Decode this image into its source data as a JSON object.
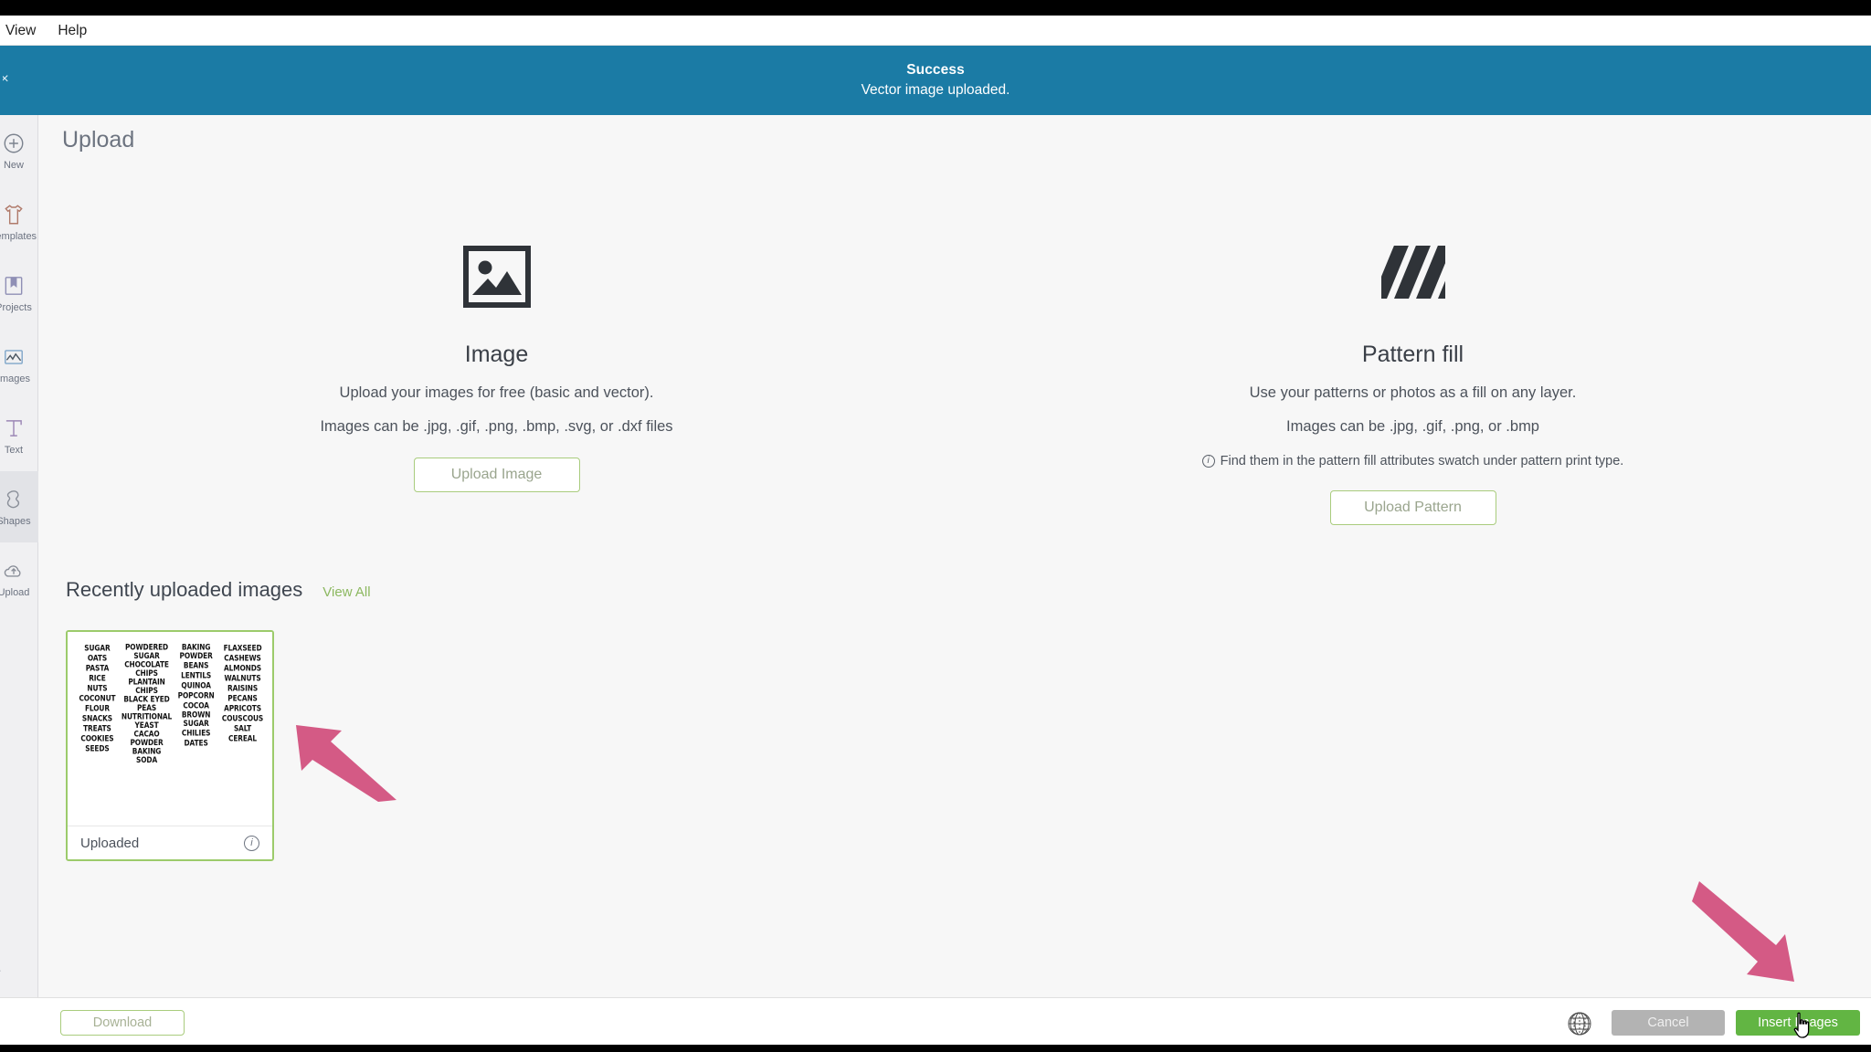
{
  "menubar": {
    "items": [
      "View",
      "Help"
    ]
  },
  "banner": {
    "title": "Success",
    "message": "Vector image uploaded.",
    "close_icon": "close-icon",
    "color": "#1b7ba5"
  },
  "sidebar": {
    "items": [
      {
        "label": "New",
        "icon": "plus-circle-icon",
        "active": false
      },
      {
        "label": "Templates",
        "icon": "tshirt-icon",
        "active": false
      },
      {
        "label": "Projects",
        "icon": "bookmark-icon",
        "active": false
      },
      {
        "label": "Images",
        "icon": "image-graph-icon",
        "active": false
      },
      {
        "label": "Text",
        "icon": "text-icon",
        "active": false
      },
      {
        "label": "Shapes",
        "icon": "shapes-icon",
        "active": true
      },
      {
        "label": "Upload",
        "icon": "upload-cloud-icon",
        "active": false
      }
    ],
    "collapse_icon": "chevron-right-icon"
  },
  "page": {
    "title": "Upload"
  },
  "cards": [
    {
      "icon": "image-icon",
      "title": "Image",
      "line1": "Upload your images for free (basic and vector).",
      "line2": "Images can be .jpg, .gif, .png, .bmp, .svg, or .dxf files",
      "note": "",
      "button": "Upload Image"
    },
    {
      "icon": "pattern-stripes-icon",
      "title": "Pattern fill",
      "line1": "Use your patterns or photos as a fill on any layer.",
      "line2": "Images can be .jpg, .gif, .png, or .bmp",
      "note": "Find them in the pattern fill attributes swatch under pattern print type.",
      "button": "Upload Pattern"
    }
  ],
  "recent": {
    "title": "Recently uploaded images",
    "view_all": "View All",
    "thumbnail": {
      "status": "Uploaded",
      "info_icon": "info-icon",
      "columns": [
        [
          "SUGAR",
          "OATS",
          "PASTA",
          "RICE",
          "NUTS",
          "COCONUT",
          "FLOUR",
          "SNACKS",
          "TREATS",
          "COOKIES",
          "SEEDS"
        ],
        [
          "POWDERED SUGAR",
          "CHOCOLATE CHIPS",
          "PLANTAIN CHIPS",
          "BLACK EYED PEAS",
          "NUTRITIONAL YEAST",
          "CACAO POWDER",
          "BAKING SODA"
        ],
        [
          "BAKING POWDER",
          "BEANS",
          "LENTILS",
          "QUINOA",
          "POPCORN",
          "COCOA",
          "BROWN SUGAR",
          "CHILIES",
          "DATES"
        ],
        [
          "FLAXSEED",
          "CASHEWS",
          "ALMONDS",
          "WALNUTS",
          "RAISINS",
          "PECANS",
          "APRICOTS",
          "COUSCOUS",
          "SALT",
          "CEREAL"
        ]
      ]
    }
  },
  "footer": {
    "download": "Download",
    "cancel": "Cancel",
    "insert": "Insert Images",
    "sphere_icon": "sphere-icon"
  },
  "annotations": {
    "arrow_color": "#d45a85",
    "arrow1": "arrow-pointing-to-thumbnail",
    "arrow2": "arrow-pointing-to-insert-images"
  }
}
